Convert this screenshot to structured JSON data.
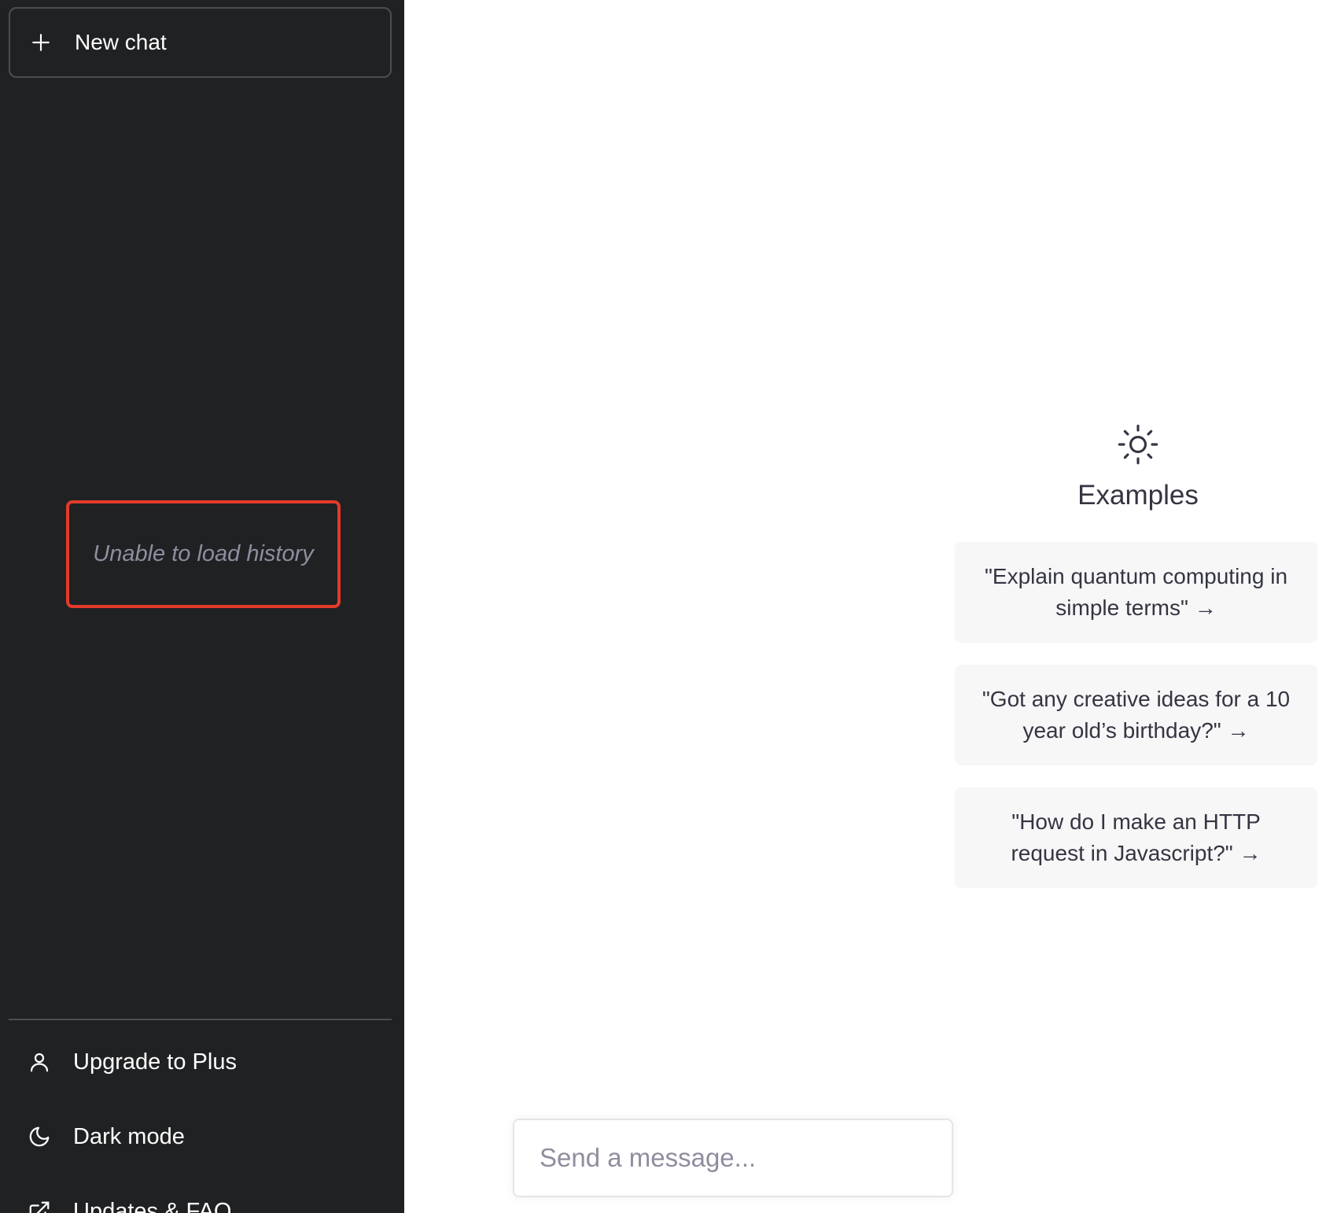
{
  "sidebar": {
    "new_chat_label": "New chat",
    "history_error": "Unable to load history",
    "menu": {
      "upgrade_label": "Upgrade to Plus",
      "dark_mode_label": "Dark mode",
      "updates_label": "Updates & FAQ"
    }
  },
  "main": {
    "examples_title": "Examples",
    "examples": [
      "\"Explain quantum computing in simple terms\" →",
      "\"Got any creative ideas for a 10 year old’s birthday?\" →",
      "\"How do I make an HTTP request in Javascript?\" →"
    ],
    "composer": {
      "placeholder": "Send a message...",
      "value": ""
    }
  },
  "colors": {
    "sidebar_bg": "#202123",
    "highlight_border": "#e33b2b",
    "card_bg": "#f7f7f8",
    "text_primary": "#343541",
    "text_muted": "#8e8ea0"
  },
  "icons": [
    "plus-icon",
    "user-icon",
    "moon-icon",
    "external-link-icon",
    "sun-icon"
  ]
}
